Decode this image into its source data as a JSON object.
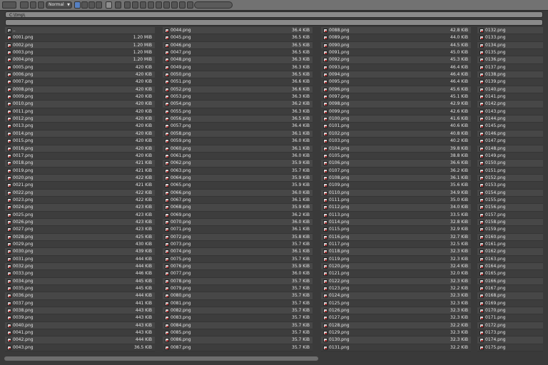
{
  "toolbar": {
    "display_mode": "Normal",
    "search_placeholder": "",
    "accent": "#5680c2"
  },
  "path": "C:\\tmp\\",
  "parent_label": "..",
  "columns": [
    {
      "files": [
        {
          "name": "0001.png",
          "size": "1.20 MiB"
        },
        {
          "name": "0002.png",
          "size": "1.20 MiB"
        },
        {
          "name": "0003.png",
          "size": "1.20 MiB"
        },
        {
          "name": "0004.png",
          "size": "1.20 MiB"
        },
        {
          "name": "0005.png",
          "size": "420 KiB"
        },
        {
          "name": "0006.png",
          "size": "420 KiB"
        },
        {
          "name": "0007.png",
          "size": "420 KiB"
        },
        {
          "name": "0008.png",
          "size": "420 KiB"
        },
        {
          "name": "0009.png",
          "size": "420 KiB"
        },
        {
          "name": "0010.png",
          "size": "420 KiB"
        },
        {
          "name": "0011.png",
          "size": "420 KiB"
        },
        {
          "name": "0012.png",
          "size": "420 KiB"
        },
        {
          "name": "0013.png",
          "size": "420 KiB"
        },
        {
          "name": "0014.png",
          "size": "420 KiB"
        },
        {
          "name": "0015.png",
          "size": "420 KiB"
        },
        {
          "name": "0016.png",
          "size": "420 KiB"
        },
        {
          "name": "0017.png",
          "size": "420 KiB"
        },
        {
          "name": "0018.png",
          "size": "421 KiB"
        },
        {
          "name": "0019.png",
          "size": "421 KiB"
        },
        {
          "name": "0020.png",
          "size": "422 KiB"
        },
        {
          "name": "0021.png",
          "size": "421 KiB"
        },
        {
          "name": "0022.png",
          "size": "422 KiB"
        },
        {
          "name": "0023.png",
          "size": "422 KiB"
        },
        {
          "name": "0024.png",
          "size": "423 KiB"
        },
        {
          "name": "0025.png",
          "size": "423 KiB"
        },
        {
          "name": "0026.png",
          "size": "423 KiB"
        },
        {
          "name": "0027.png",
          "size": "423 KiB"
        },
        {
          "name": "0028.png",
          "size": "425 KiB"
        },
        {
          "name": "0029.png",
          "size": "430 KiB"
        },
        {
          "name": "0030.png",
          "size": "439 KiB"
        },
        {
          "name": "0031.png",
          "size": "444 KiB"
        },
        {
          "name": "0032.png",
          "size": "444 KiB"
        },
        {
          "name": "0033.png",
          "size": "446 KiB"
        },
        {
          "name": "0034.png",
          "size": "445 KiB"
        },
        {
          "name": "0035.png",
          "size": "445 KiB"
        },
        {
          "name": "0036.png",
          "size": "444 KiB"
        },
        {
          "name": "0037.png",
          "size": "441 KiB"
        },
        {
          "name": "0038.png",
          "size": "443 KiB"
        },
        {
          "name": "0039.png",
          "size": "443 KiB"
        },
        {
          "name": "0040.png",
          "size": "443 KiB"
        },
        {
          "name": "0041.png",
          "size": "443 KiB"
        },
        {
          "name": "0042.png",
          "size": "444 KiB"
        },
        {
          "name": "0043.png",
          "size": "36.5 KiB"
        }
      ]
    },
    {
      "files": [
        {
          "name": "0044.png",
          "size": "36.4 KiB"
        },
        {
          "name": "0045.png",
          "size": "36.5 KiB"
        },
        {
          "name": "0046.png",
          "size": "36.5 KiB"
        },
        {
          "name": "0047.png",
          "size": "36.5 KiB"
        },
        {
          "name": "0048.png",
          "size": "36.3 KiB"
        },
        {
          "name": "0049.png",
          "size": "36.3 KiB"
        },
        {
          "name": "0050.png",
          "size": "36.5 KiB"
        },
        {
          "name": "0051.png",
          "size": "36.6 KiB"
        },
        {
          "name": "0052.png",
          "size": "36.6 KiB"
        },
        {
          "name": "0053.png",
          "size": "36.3 KiB"
        },
        {
          "name": "0054.png",
          "size": "36.2 KiB"
        },
        {
          "name": "0055.png",
          "size": "36.3 KiB"
        },
        {
          "name": "0056.png",
          "size": "36.5 KiB"
        },
        {
          "name": "0057.png",
          "size": "36.4 KiB"
        },
        {
          "name": "0058.png",
          "size": "36.1 KiB"
        },
        {
          "name": "0059.png",
          "size": "36.0 KiB"
        },
        {
          "name": "0060.png",
          "size": "36.1 KiB"
        },
        {
          "name": "0061.png",
          "size": "36.0 KiB"
        },
        {
          "name": "0062.png",
          "size": "35.9 KiB"
        },
        {
          "name": "0063.png",
          "size": "35.7 KiB"
        },
        {
          "name": "0064.png",
          "size": "35.9 KiB"
        },
        {
          "name": "0065.png",
          "size": "35.9 KiB"
        },
        {
          "name": "0066.png",
          "size": "36.0 KiB"
        },
        {
          "name": "0067.png",
          "size": "36.1 KiB"
        },
        {
          "name": "0068.png",
          "size": "35.9 KiB"
        },
        {
          "name": "0069.png",
          "size": "36.2 KiB"
        },
        {
          "name": "0070.png",
          "size": "36.0 KiB"
        },
        {
          "name": "0071.png",
          "size": "36.1 KiB"
        },
        {
          "name": "0072.png",
          "size": "35.8 KiB"
        },
        {
          "name": "0073.png",
          "size": "35.7 KiB"
        },
        {
          "name": "0074.png",
          "size": "36.1 KiB"
        },
        {
          "name": "0075.png",
          "size": "35.7 KiB"
        },
        {
          "name": "0076.png",
          "size": "35.9 KiB"
        },
        {
          "name": "0077.png",
          "size": "36.0 KiB"
        },
        {
          "name": "0078.png",
          "size": "35.7 KiB"
        },
        {
          "name": "0079.png",
          "size": "35.7 KiB"
        },
        {
          "name": "0080.png",
          "size": "35.7 KiB"
        },
        {
          "name": "0081.png",
          "size": "35.7 KiB"
        },
        {
          "name": "0082.png",
          "size": "35.7 KiB"
        },
        {
          "name": "0083.png",
          "size": "35.7 KiB"
        },
        {
          "name": "0084.png",
          "size": "35.7 KiB"
        },
        {
          "name": "0085.png",
          "size": "35.7 KiB"
        },
        {
          "name": "0086.png",
          "size": "35.7 KiB"
        },
        {
          "name": "0087.png",
          "size": "35.7 KiB"
        }
      ]
    },
    {
      "files": [
        {
          "name": "0088.png",
          "size": "42.8 KiB"
        },
        {
          "name": "0089.png",
          "size": "44.0 KiB"
        },
        {
          "name": "0090.png",
          "size": "44.5 KiB"
        },
        {
          "name": "0091.png",
          "size": "45.0 KiB"
        },
        {
          "name": "0092.png",
          "size": "45.3 KiB"
        },
        {
          "name": "0093.png",
          "size": "46.4 KiB"
        },
        {
          "name": "0094.png",
          "size": "46.4 KiB"
        },
        {
          "name": "0095.png",
          "size": "46.4 KiB"
        },
        {
          "name": "0096.png",
          "size": "45.6 KiB"
        },
        {
          "name": "0097.png",
          "size": "45.1 KiB"
        },
        {
          "name": "0098.png",
          "size": "42.9 KiB"
        },
        {
          "name": "0099.png",
          "size": "42.6 KiB"
        },
        {
          "name": "0100.png",
          "size": "41.6 KiB"
        },
        {
          "name": "0101.png",
          "size": "40.6 KiB"
        },
        {
          "name": "0102.png",
          "size": "40.8 KiB"
        },
        {
          "name": "0103.png",
          "size": "40.2 KiB"
        },
        {
          "name": "0104.png",
          "size": "39.8 KiB"
        },
        {
          "name": "0105.png",
          "size": "38.8 KiB"
        },
        {
          "name": "0106.png",
          "size": "36.6 KiB"
        },
        {
          "name": "0107.png",
          "size": "36.2 KiB"
        },
        {
          "name": "0108.png",
          "size": "36.1 KiB"
        },
        {
          "name": "0109.png",
          "size": "35.6 KiB"
        },
        {
          "name": "0110.png",
          "size": "34.9 KiB"
        },
        {
          "name": "0111.png",
          "size": "35.0 KiB"
        },
        {
          "name": "0112.png",
          "size": "34.0 KiB"
        },
        {
          "name": "0113.png",
          "size": "33.5 KiB"
        },
        {
          "name": "0114.png",
          "size": "32.8 KiB"
        },
        {
          "name": "0115.png",
          "size": "32.9 KiB"
        },
        {
          "name": "0116.png",
          "size": "32.7 KiB"
        },
        {
          "name": "0117.png",
          "size": "32.5 KiB"
        },
        {
          "name": "0118.png",
          "size": "32.3 KiB"
        },
        {
          "name": "0119.png",
          "size": "32.3 KiB"
        },
        {
          "name": "0120.png",
          "size": "32.4 KiB"
        },
        {
          "name": "0121.png",
          "size": "32.0 KiB"
        },
        {
          "name": "0122.png",
          "size": "32.3 KiB"
        },
        {
          "name": "0123.png",
          "size": "32.2 KiB"
        },
        {
          "name": "0124.png",
          "size": "32.3 KiB"
        },
        {
          "name": "0125.png",
          "size": "32.3 KiB"
        },
        {
          "name": "0126.png",
          "size": "32.3 KiB"
        },
        {
          "name": "0127.png",
          "size": "32.3 KiB"
        },
        {
          "name": "0128.png",
          "size": "32.2 KiB"
        },
        {
          "name": "0129.png",
          "size": "32.3 KiB"
        },
        {
          "name": "0130.png",
          "size": "32.3 KiB"
        },
        {
          "name": "0131.png",
          "size": "32.2 KiB"
        }
      ]
    },
    {
      "files": [
        {
          "name": "0132.png",
          "size": ""
        },
        {
          "name": "0133.png",
          "size": ""
        },
        {
          "name": "0134.png",
          "size": ""
        },
        {
          "name": "0135.png",
          "size": ""
        },
        {
          "name": "0136.png",
          "size": ""
        },
        {
          "name": "0137.png",
          "size": ""
        },
        {
          "name": "0138.png",
          "size": ""
        },
        {
          "name": "0139.png",
          "size": ""
        },
        {
          "name": "0140.png",
          "size": ""
        },
        {
          "name": "0141.png",
          "size": ""
        },
        {
          "name": "0142.png",
          "size": ""
        },
        {
          "name": "0143.png",
          "size": ""
        },
        {
          "name": "0144.png",
          "size": ""
        },
        {
          "name": "0145.png",
          "size": ""
        },
        {
          "name": "0146.png",
          "size": ""
        },
        {
          "name": "0147.png",
          "size": ""
        },
        {
          "name": "0148.png",
          "size": ""
        },
        {
          "name": "0149.png",
          "size": ""
        },
        {
          "name": "0150.png",
          "size": ""
        },
        {
          "name": "0151.png",
          "size": ""
        },
        {
          "name": "0152.png",
          "size": ""
        },
        {
          "name": "0153.png",
          "size": ""
        },
        {
          "name": "0154.png",
          "size": ""
        },
        {
          "name": "0155.png",
          "size": ""
        },
        {
          "name": "0156.png",
          "size": ""
        },
        {
          "name": "0157.png",
          "size": ""
        },
        {
          "name": "0158.png",
          "size": ""
        },
        {
          "name": "0159.png",
          "size": ""
        },
        {
          "name": "0160.png",
          "size": ""
        },
        {
          "name": "0161.png",
          "size": ""
        },
        {
          "name": "0162.png",
          "size": ""
        },
        {
          "name": "0163.png",
          "size": ""
        },
        {
          "name": "0164.png",
          "size": ""
        },
        {
          "name": "0165.png",
          "size": ""
        },
        {
          "name": "0166.png",
          "size": ""
        },
        {
          "name": "0167.png",
          "size": ""
        },
        {
          "name": "0168.png",
          "size": ""
        },
        {
          "name": "0169.png",
          "size": ""
        },
        {
          "name": "0170.png",
          "size": ""
        },
        {
          "name": "0171.png",
          "size": ""
        },
        {
          "name": "0172.png",
          "size": ""
        },
        {
          "name": "0173.png",
          "size": ""
        },
        {
          "name": "0174.png",
          "size": ""
        },
        {
          "name": "0175.png",
          "size": ""
        }
      ]
    }
  ]
}
